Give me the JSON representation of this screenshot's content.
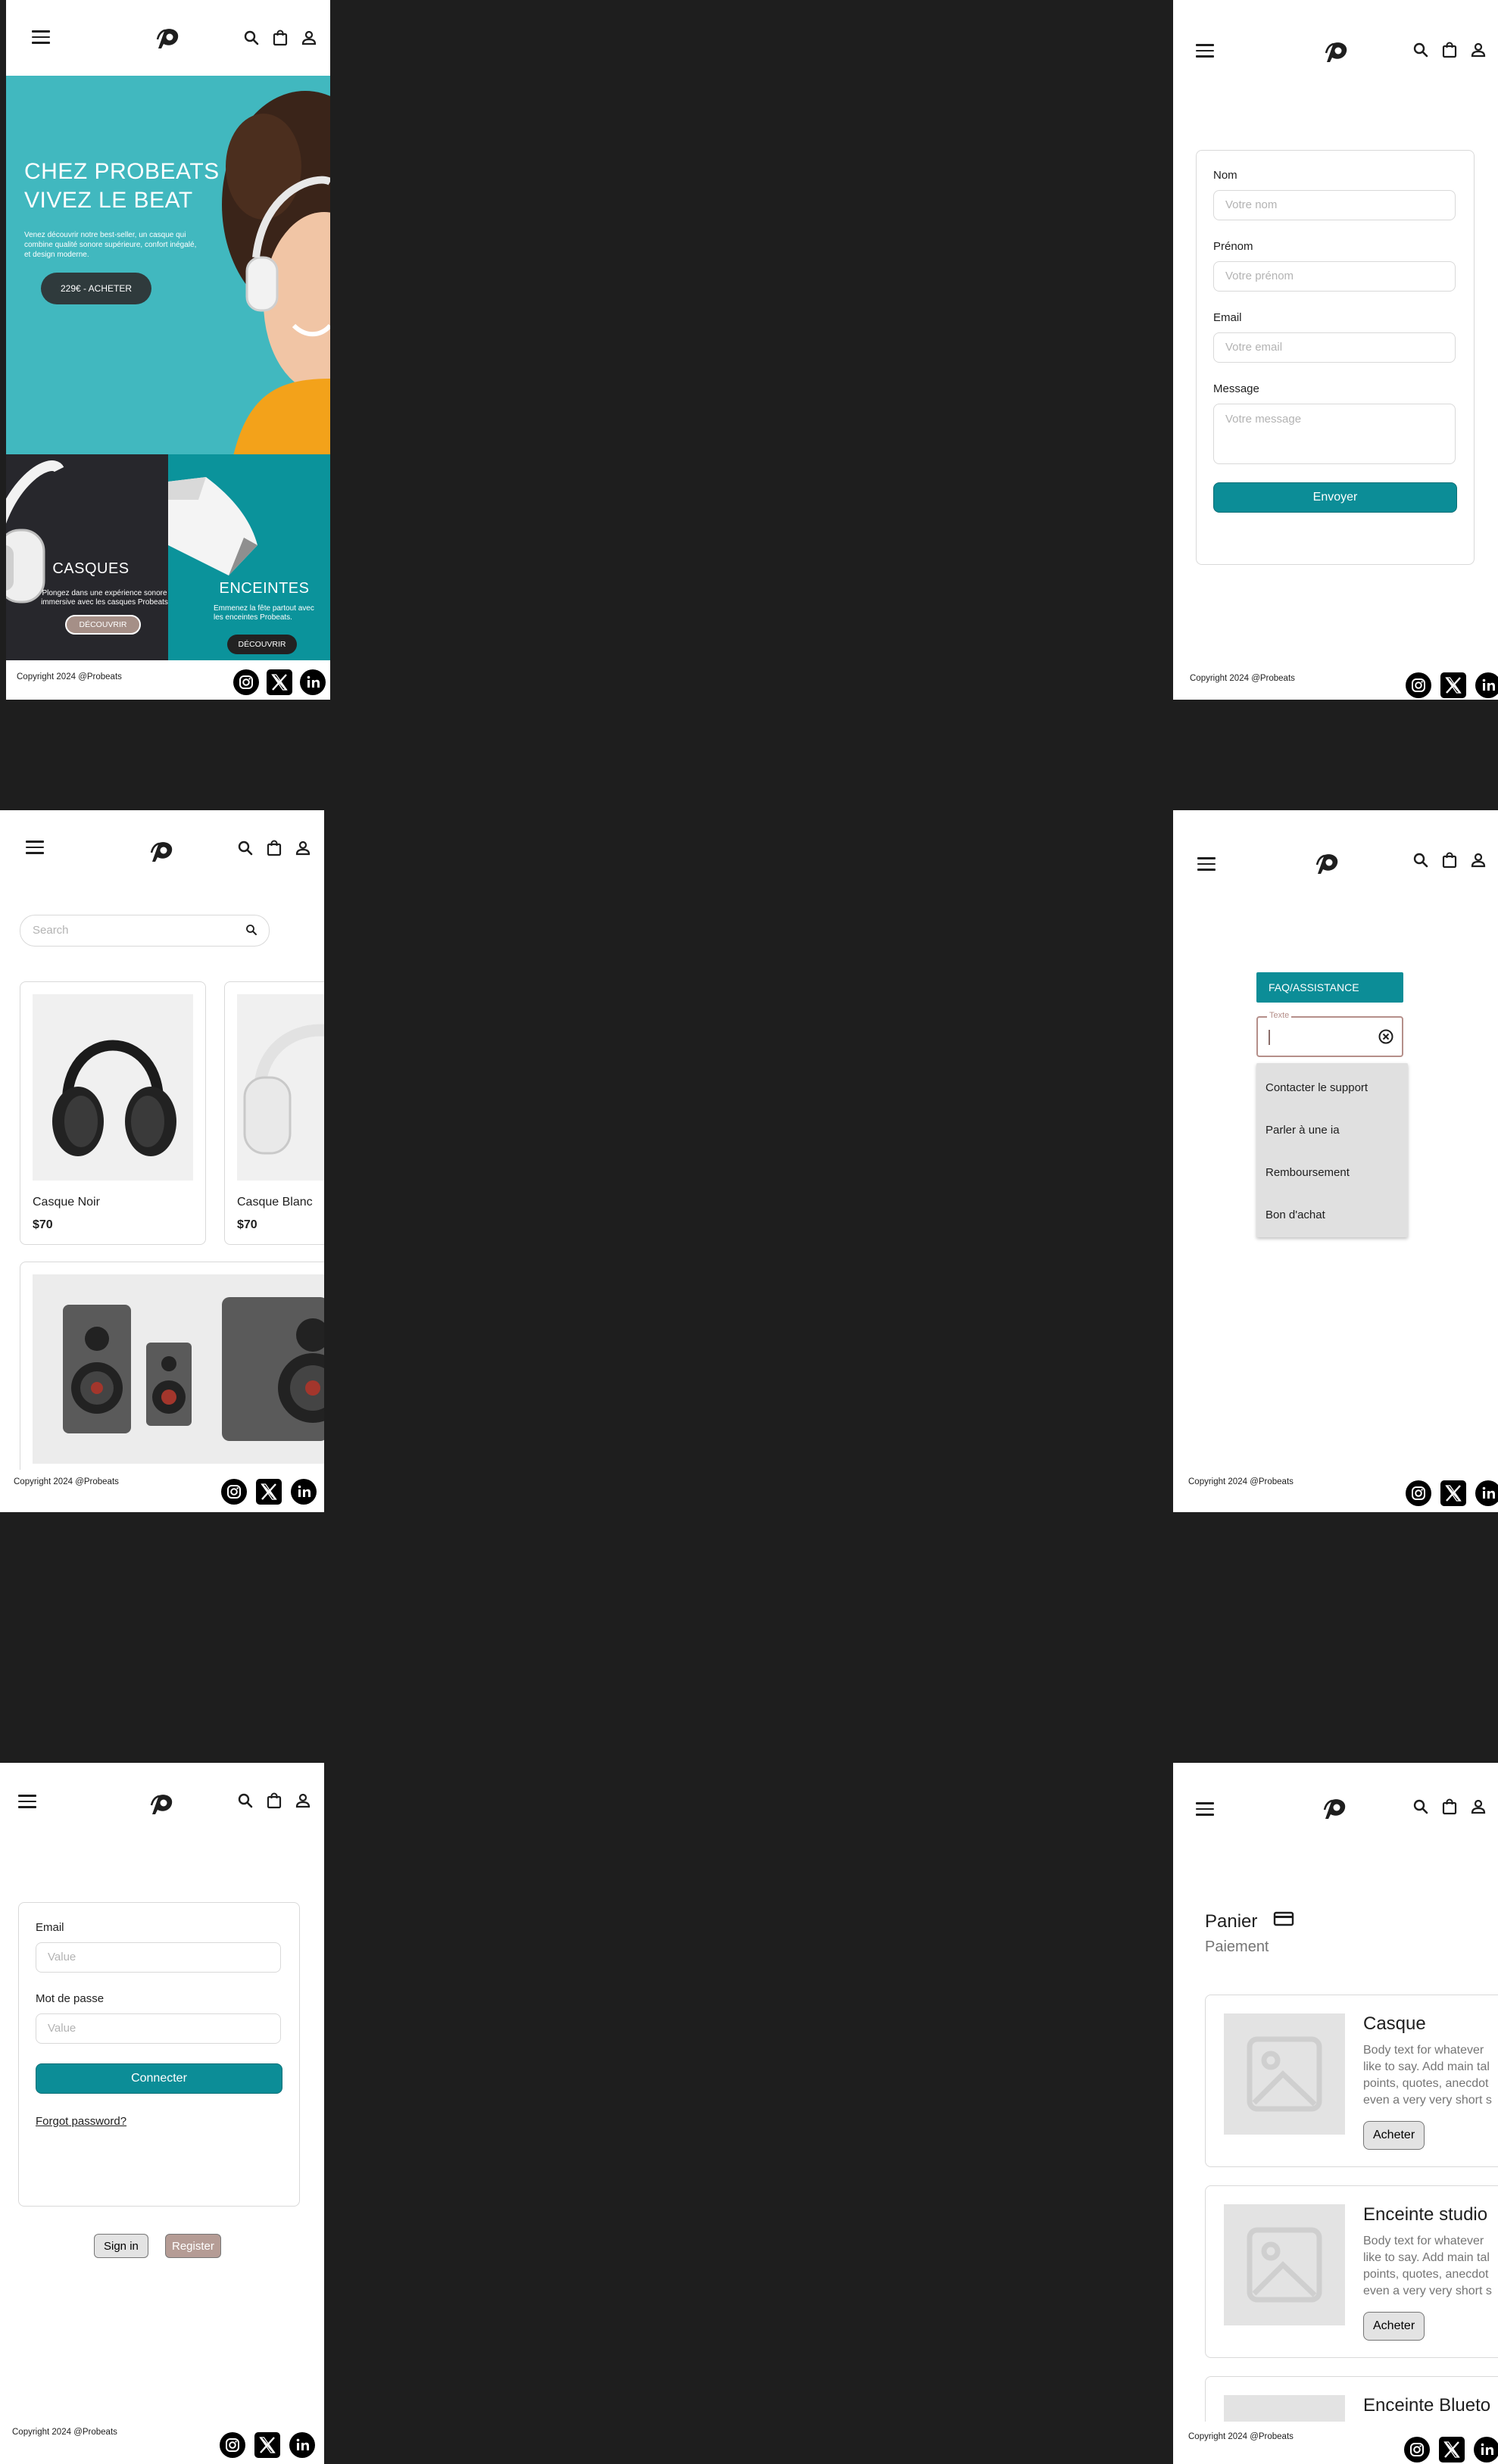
{
  "shared": {
    "copyright": "Copyright 2024 @Probeats",
    "icons": {
      "menu": "menu-icon",
      "logo": "probeats-logo",
      "search": "search-icon",
      "bag": "shopping-bag-icon",
      "user": "user-icon",
      "instagram": "instagram-icon",
      "x": "x-icon",
      "linkedin": "linkedin-icon"
    },
    "colors": {
      "teal": "#0c8d97",
      "hero_bg": "#41b8bf",
      "dark_tile": "#27272c",
      "teal_tile": "#0b939b",
      "canvas": "#1e1e1e"
    }
  },
  "home": {
    "hero_title_1": "CHEZ PROBEATS",
    "hero_title_2": "VIVEZ LE BEAT",
    "hero_text": "Venez découvrir notre best-seller, un casque qui combine qualité sonore supérieure, confort inégalé, et design moderne.",
    "hero_button": "229€ - ACHETER",
    "tile_headphones": {
      "title": "CASQUES",
      "text": "Plongez dans une expérience sonore immersive avec les casques Probeats",
      "button": "DÉCOUVRIR"
    },
    "tile_speakers": {
      "title": "ENCEINTES",
      "text": "Emmenez la fête partout avec les enceintes Probeats.",
      "button": "DÉCOUVRIR"
    }
  },
  "contact": {
    "name_label": "Nom",
    "name_placeholder": "Votre nom",
    "firstname_label": "Prénom",
    "firstname_placeholder": "Votre prénom",
    "email_label": "Email",
    "email_placeholder": "Votre email",
    "message_label": "Message",
    "message_placeholder": "Votre message",
    "submit": "Envoyer"
  },
  "shop": {
    "search_placeholder": "Search",
    "products": [
      {
        "name": "Casque Noir",
        "price": "$70"
      },
      {
        "name": "Casque Blanc",
        "price": "$70"
      }
    ]
  },
  "faq": {
    "button": "FAQ/ASSISTANCE",
    "field_label": "Texte",
    "options": [
      "Contacter le support",
      "Parler à une ia",
      "Remboursement",
      "Bon d'achat"
    ]
  },
  "login": {
    "email_label": "Email",
    "email_placeholder": "Value",
    "password_label": "Mot de passe",
    "password_placeholder": "Value",
    "submit": "Connecter",
    "forgot": "Forgot password?",
    "sign_in": "Sign in",
    "register": "Register"
  },
  "cart": {
    "title": "Panier",
    "subtitle": "Paiement",
    "items": [
      {
        "title": "Casque",
        "body": [
          "Body text for whatever",
          "like to say. Add main tal",
          "points, quotes, anecdot",
          "even a very very short s"
        ],
        "button": "Acheter"
      },
      {
        "title": "Enceinte studio",
        "body": [
          "Body text for whatever",
          "like to say. Add main tal",
          "points, quotes, anecdot",
          "even a very very short s"
        ],
        "button": "Acheter"
      },
      {
        "title": "Enceinte Blueto"
      }
    ]
  }
}
